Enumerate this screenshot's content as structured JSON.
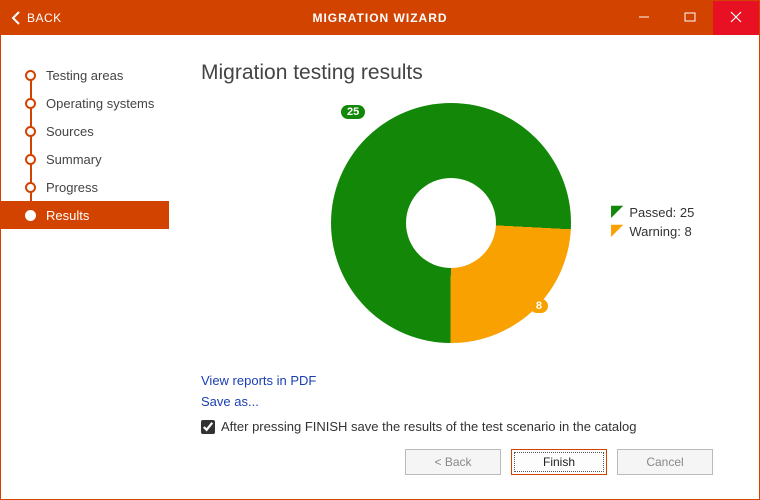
{
  "titlebar": {
    "back_label": "BACK",
    "title": "MIGRATION WIZARD"
  },
  "sidebar": {
    "steps": [
      {
        "label": "Testing areas"
      },
      {
        "label": "Operating systems"
      },
      {
        "label": "Sources"
      },
      {
        "label": "Summary"
      },
      {
        "label": "Progress"
      },
      {
        "label": "Results"
      }
    ],
    "active_index": 5
  },
  "main": {
    "title": "Migration testing results",
    "view_reports_label": "View reports in PDF",
    "save_as_label": "Save as...",
    "checkbox_label": "After pressing FINISH save the results of the test scenario in the catalog",
    "checkbox_checked": true
  },
  "chart_data": {
    "type": "pie",
    "title": "Migration testing results",
    "series": [
      {
        "name": "Passed",
        "value": 25,
        "color": "#138808"
      },
      {
        "name": "Warning",
        "value": 8,
        "color": "#f8a100"
      }
    ],
    "legend_position": "right",
    "donut": true
  },
  "legend": {
    "passed_label": "Passed: 25",
    "warning_label": "Warning: 8"
  },
  "data_labels": {
    "passed": "25",
    "warning": "8"
  },
  "footer": {
    "back_label": "< Back",
    "finish_label": "Finish",
    "cancel_label": "Cancel"
  },
  "colors": {
    "accent": "#d24300",
    "passed": "#138808",
    "warning": "#f8a100",
    "close": "#e81123"
  }
}
